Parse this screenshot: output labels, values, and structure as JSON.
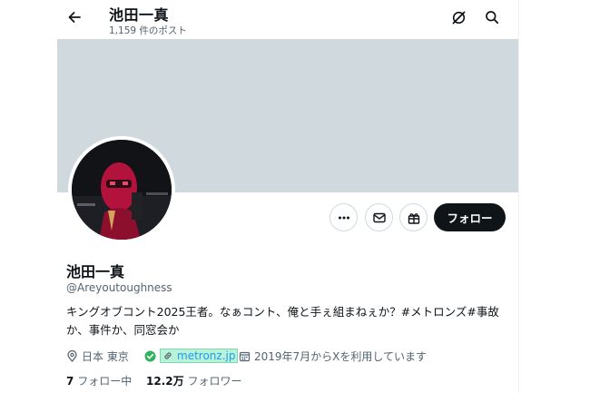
{
  "header": {
    "name": "池田一真",
    "post_count": "1,159 件のポスト",
    "back_icon": "back-arrow-icon",
    "grok_icon": "grok-icon",
    "search_icon": "search-icon"
  },
  "profile": {
    "name": "池田一真",
    "handle": "@Areyoutoughness",
    "bio_lines": [
      "キングオブコント2025王者。なぁコント、俺と手ぇ組まねぇか？#メトロンズ#事故",
      "か、事件か、同窓会か"
    ],
    "location": "日本 東京",
    "link": "metronz.jp",
    "joined": "2019年7月からXを利用しています",
    "following_count": "7",
    "following_label": "フォロー中",
    "followers_count": "12.2万",
    "followers_label": "フォロワー"
  },
  "actions": {
    "more_icon": "more-icon",
    "message_icon": "mail-icon",
    "subscribe_icon": "gift-icon",
    "follow_label": "フォロー"
  },
  "colors": {
    "banner": "#cfd9de",
    "link": "#1d9bf0",
    "follow_button": "#0f1419",
    "secondary_text": "#536471"
  }
}
